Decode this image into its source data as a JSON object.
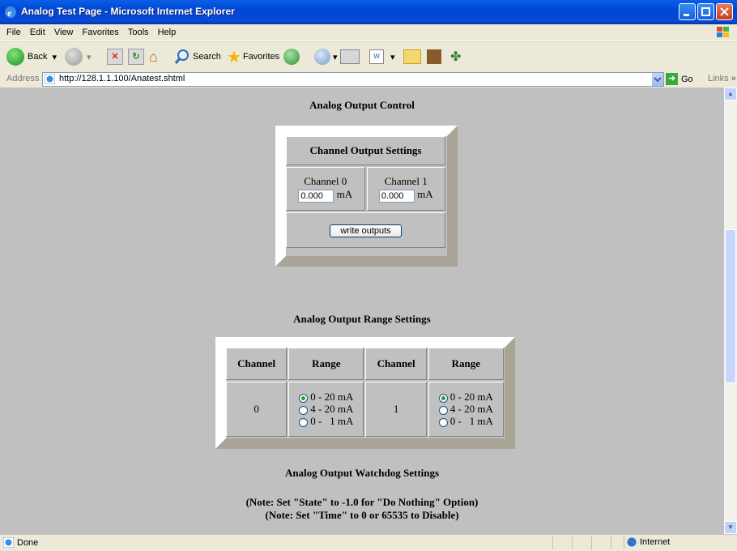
{
  "window": {
    "title": "Analog Test Page - Microsoft Internet Explorer"
  },
  "menu": [
    "File",
    "Edit",
    "View",
    "Favorites",
    "Tools",
    "Help"
  ],
  "toolbar": {
    "back": "Back",
    "search": "Search",
    "favorites": "Favorites"
  },
  "address": {
    "label": "Address",
    "url": "http://128.1.1.100/Anatest.shtml",
    "go": "Go",
    "links": "Links"
  },
  "page": {
    "heading1": "Analog Output Control",
    "channel_settings": {
      "title": "Channel Output Settings",
      "ch0_label": "Channel 0",
      "ch0_value": "0.000",
      "ch0_unit": "mA",
      "ch1_label": "Channel 1",
      "ch1_value": "0.000",
      "ch1_unit": "mA",
      "write_button": "write outputs"
    },
    "heading2": "Analog Output Range Settings",
    "range_table": {
      "col_channel": "Channel",
      "col_range": "Range",
      "left_channel": "0",
      "right_channel": "1",
      "options": [
        "0 - 20 mA",
        "4 - 20 mA",
        "0 -   1 mA"
      ],
      "left_selected": 0,
      "right_selected": 0
    },
    "heading3": "Analog Output Watchdog Settings",
    "note1": "(Note: Set \"State\" to -1.0 for \"Do Nothing\" Option)",
    "note2": "(Note: Set \"Time\" to 0 or 65535 to Disable)"
  },
  "status": {
    "left": "Done",
    "zone": "Internet"
  }
}
